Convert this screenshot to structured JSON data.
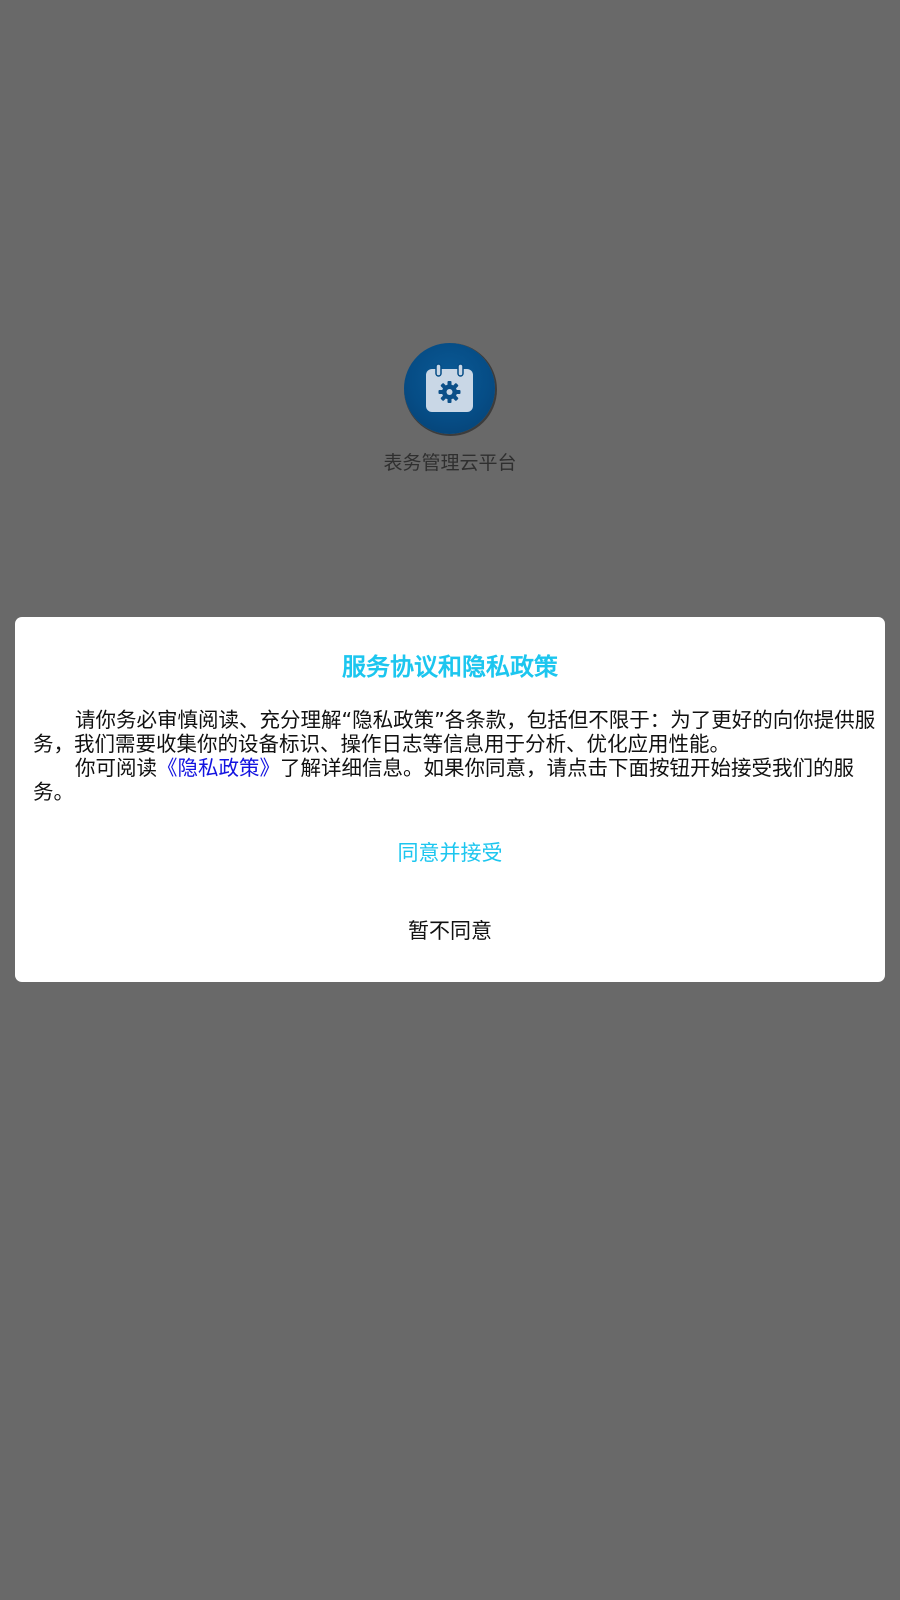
{
  "app": {
    "name": "表务管理云平台",
    "icon": "calendar-gear-icon",
    "icon_color": "#064d86"
  },
  "dialog": {
    "title": "服务协议和隐私政策",
    "paragraph1": "请你务必审慎阅读、充分理解“隐私政策”各条款，包括但不限于：为了更好的向你提供服务，我们需要收集你的设备标识、操作日志等信息用于分析、优化应用性能。",
    "paragraph2_prefix": "你可阅读",
    "policy_link": "《隐私政策》",
    "paragraph2_suffix": "了解详细信息。如果你同意，请点击下面按钮开始接受我们的服务。",
    "agree_label": "同意并接受",
    "decline_label": "暂不同意"
  },
  "colors": {
    "backdrop": "#696969",
    "accent": "#1cc6ef",
    "link": "#1414e0",
    "dialog_bg": "#ffffff"
  }
}
